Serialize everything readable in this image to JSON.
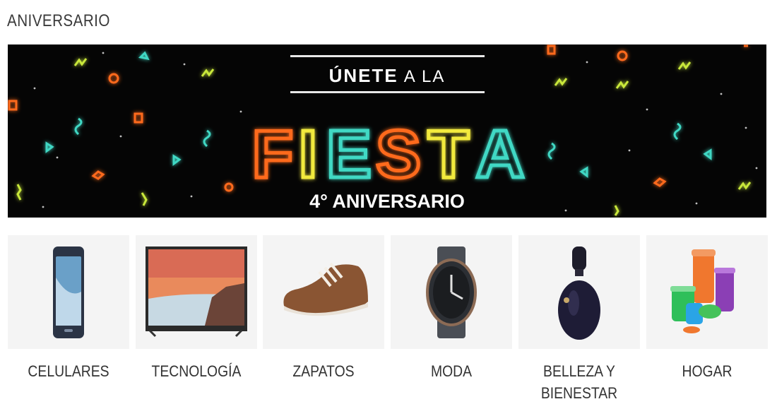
{
  "section": {
    "title": "ANIVERSARIO"
  },
  "banner": {
    "line1_big": "ÚNETE",
    "line1_small": "A LA",
    "headline": "FIESTA",
    "subline": "4° ANIVERSARIO",
    "colors": {
      "background": "#050505",
      "orange": "#ff6a1f",
      "yellow": "#f2ea3c",
      "teal": "#3fd8c4",
      "green_yellow": "#c9e83a"
    }
  },
  "categories": [
    {
      "label": "CELULARES",
      "icon": "smartphone-image"
    },
    {
      "label": "TECNOLOGÍA",
      "icon": "television-image"
    },
    {
      "label": "ZAPATOS",
      "icon": "shoe-image"
    },
    {
      "label": "MODA",
      "icon": "watch-image"
    },
    {
      "label": "BELLEZA Y\nBIENESTAR",
      "icon": "perfume-image"
    },
    {
      "label": "HOGAR",
      "icon": "containers-image"
    }
  ]
}
